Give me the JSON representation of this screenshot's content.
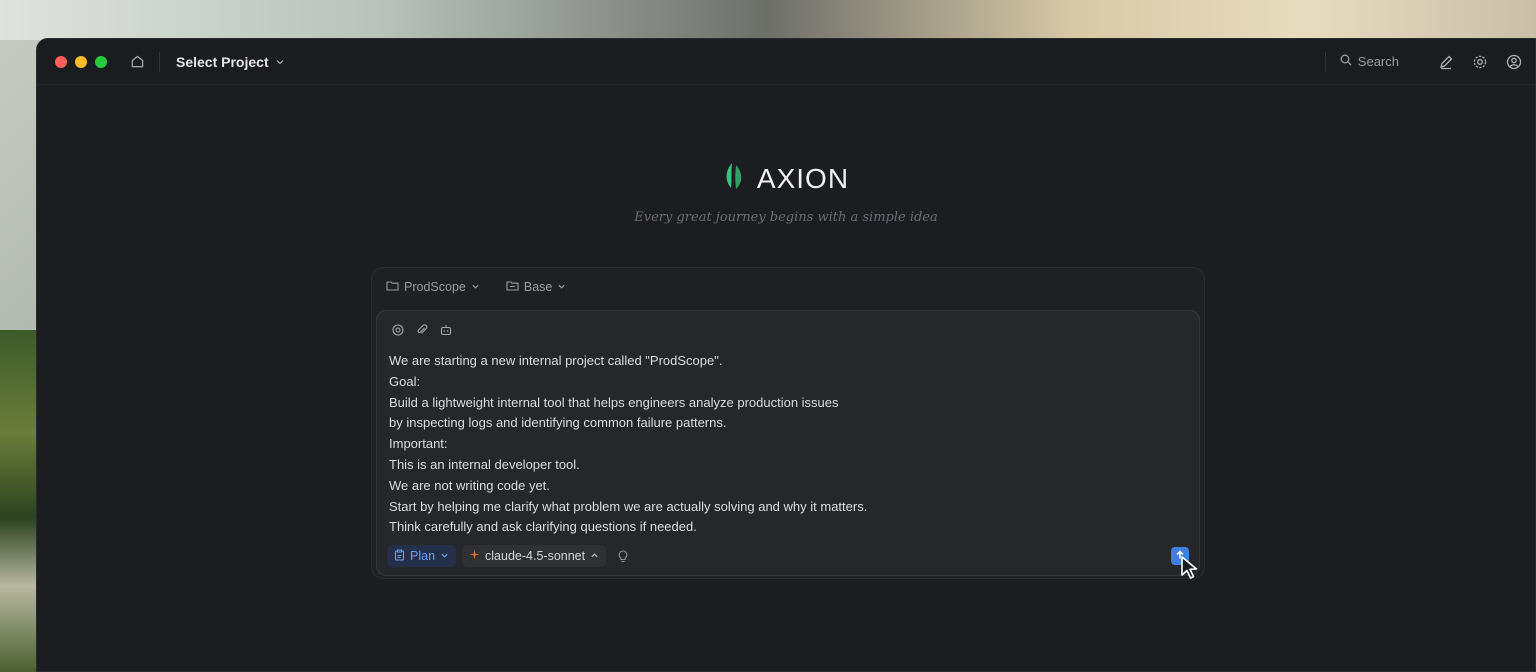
{
  "titlebar": {
    "project_label": "Select Project",
    "search_label": "Search"
  },
  "brand": {
    "name": "AXION",
    "tagline": "Every great journey begins with a simple idea",
    "accent_color": "#3fbf7f"
  },
  "composer": {
    "context": {
      "project": "ProdScope",
      "branch": "Base"
    },
    "prompt_lines": [
      "We are starting a new internal project called \"ProdScope\".",
      "Goal:",
      "Build a lightweight internal tool that helps engineers analyze production issues",
      "by inspecting logs and identifying common failure patterns.",
      "Important:",
      "This is an internal developer tool.",
      "We are not writing code yet.",
      "Start by helping me clarify what problem we are actually solving and why it matters.",
      "Think carefully and ask clarifying questions if needed."
    ],
    "mode_label": "Plan",
    "model_label": "claude-4.5-sonnet",
    "send_color": "#3f7fe0"
  }
}
